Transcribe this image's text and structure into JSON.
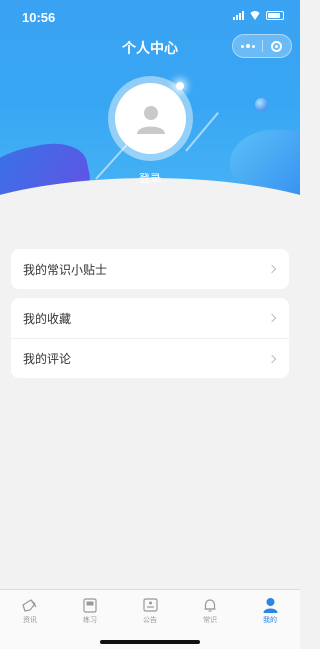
{
  "status_bar": {
    "time": "10:56"
  },
  "header": {
    "title": "个人中心"
  },
  "profile": {
    "login_label": "登录"
  },
  "menu_groups": [
    {
      "items": [
        {
          "label": "我的常识小贴士"
        }
      ]
    },
    {
      "items": [
        {
          "label": "我的收藏"
        },
        {
          "label": "我的评论"
        }
      ]
    }
  ],
  "tabbar": {
    "items": [
      {
        "label": "资讯",
        "icon": "news-icon",
        "active": false
      },
      {
        "label": "练习",
        "icon": "book-icon",
        "active": false
      },
      {
        "label": "公告",
        "icon": "announcement-icon",
        "active": false
      },
      {
        "label": "常识",
        "icon": "bell-icon",
        "active": false
      },
      {
        "label": "我的",
        "icon": "user-icon",
        "active": true
      }
    ]
  },
  "colors": {
    "accent": "#2b86e8",
    "hero": "#3aa2f2",
    "inactive": "#999999"
  }
}
